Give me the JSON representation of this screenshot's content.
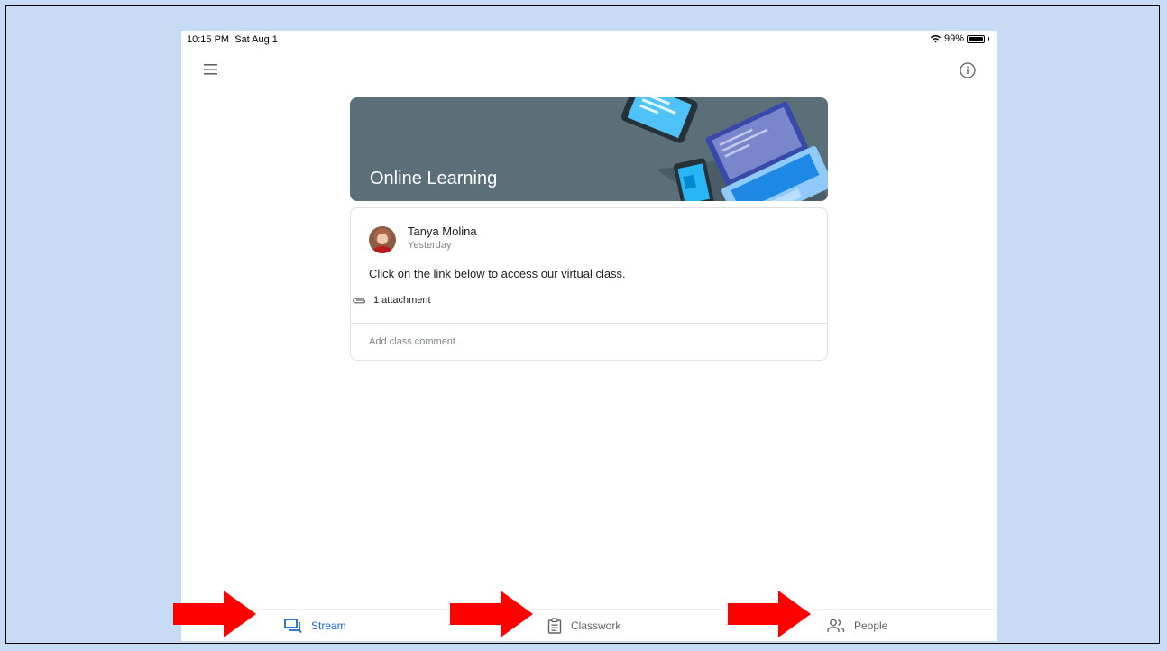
{
  "status_bar": {
    "time": "10:15 PM",
    "date": "Sat Aug 1",
    "battery": "99%",
    "battery_level": 0.99
  },
  "header": {
    "menu_icon": "hamburger-menu-icon",
    "info_icon": "info-circle-icon"
  },
  "class_banner": {
    "title": "Online Learning"
  },
  "post": {
    "author": "Tanya Molina",
    "date": "Yesterday",
    "text": "Click on the link below to access our virtual class.",
    "attachment_label": "1 attachment",
    "comment_placeholder": "Add class comment"
  },
  "bottom_nav": {
    "items": [
      {
        "label": "Stream",
        "icon": "stream-icon",
        "active": true
      },
      {
        "label": "Classwork",
        "icon": "clipboard-icon",
        "active": false
      },
      {
        "label": "People",
        "icon": "people-icon",
        "active": false
      }
    ]
  },
  "colors": {
    "accent": "#1967d2",
    "banner": "#5b6f79",
    "backdrop": "#c7dbf4",
    "annotation_arrow": "#ff0000"
  }
}
